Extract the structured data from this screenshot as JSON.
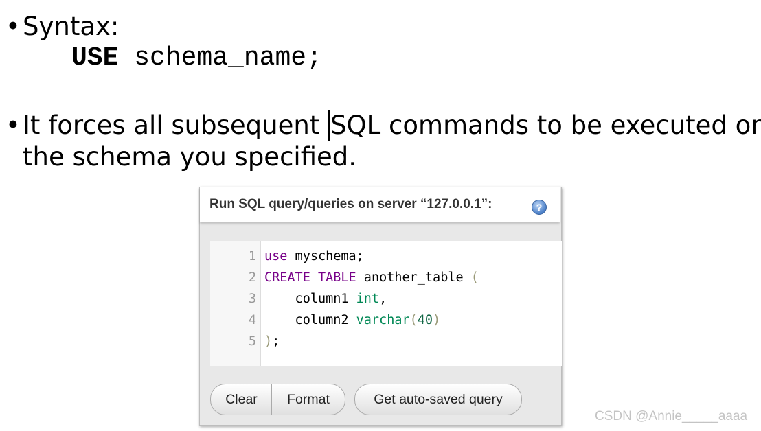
{
  "slide": {
    "bullet_symbol": "•",
    "bullets": [
      {
        "text": "Syntax:"
      },
      {
        "text_before_caret": "It forces all subsequent ",
        "text_after_caret": "SQL commands to be executed on",
        "text_line2": "the schema you specified."
      }
    ],
    "syntax": {
      "keyword": "USE",
      "rest": " schema_name;"
    }
  },
  "panel": {
    "title": "Run SQL query/queries on server “127.0.0.1”:",
    "help_icon": "help-icon",
    "help_glyph": "?",
    "editor": {
      "lines": [
        {
          "num": "1",
          "tokens": [
            {
              "t": "use",
              "c": "kw"
            },
            {
              "t": " myschema;",
              "c": ""
            }
          ]
        },
        {
          "num": "2",
          "tokens": [
            {
              "t": "CREATE",
              "c": "kw"
            },
            {
              "t": " ",
              "c": ""
            },
            {
              "t": "TABLE",
              "c": "kw"
            },
            {
              "t": " another_table ",
              "c": ""
            },
            {
              "t": "(",
              "c": "br"
            }
          ]
        },
        {
          "num": "3",
          "tokens": [
            {
              "t": "    column1 ",
              "c": ""
            },
            {
              "t": "int",
              "c": "type"
            },
            {
              "t": ",",
              "c": ""
            }
          ]
        },
        {
          "num": "4",
          "tokens": [
            {
              "t": "    column2 ",
              "c": ""
            },
            {
              "t": "varchar",
              "c": "type"
            },
            {
              "t": "(",
              "c": "br"
            },
            {
              "t": "40",
              "c": "num"
            },
            {
              "t": ")",
              "c": "br"
            }
          ]
        },
        {
          "num": "5",
          "tokens": [
            {
              "t": ")",
              "c": "br"
            },
            {
              "t": ";",
              "c": ""
            }
          ]
        }
      ]
    },
    "buttons": {
      "clear": "Clear",
      "format": "Format",
      "autosave": "Get auto-saved query"
    }
  },
  "watermark": "CSDN @Annie_____aaaa",
  "colors": {
    "keyword": "#770088",
    "type": "#008855",
    "number": "#116644",
    "bracket": "#999977"
  }
}
